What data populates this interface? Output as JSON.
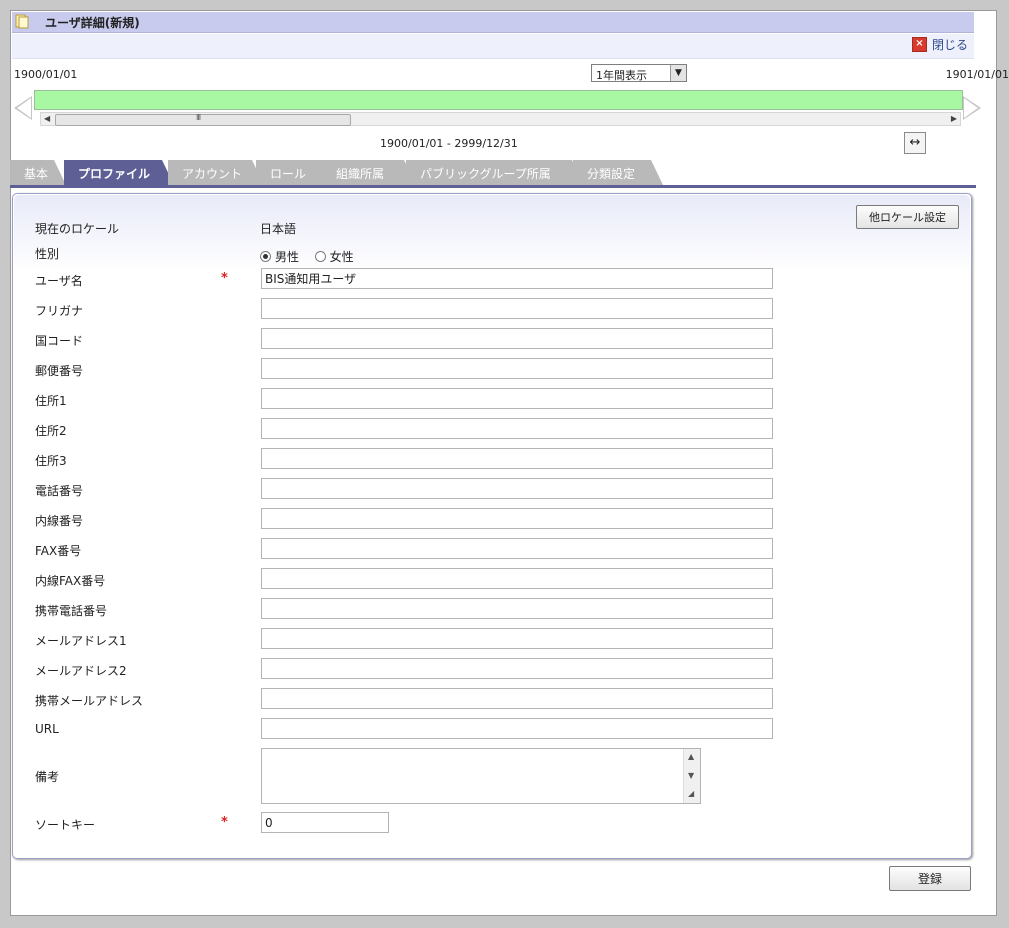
{
  "header": {
    "title": "ユーザ詳細(新規)",
    "close_label": "閉じる"
  },
  "timeline": {
    "start_date": "1900/01/01",
    "end_date": "1901/01/01",
    "period_select": "1年間表示",
    "range": "1900/01/01 - 2999/12/31",
    "bar_color": "#a8f7a3"
  },
  "tabs": [
    {
      "label": "基本",
      "active": false
    },
    {
      "label": "プロファイル",
      "active": true
    },
    {
      "label": "アカウント",
      "active": false
    },
    {
      "label": "ロール",
      "active": false
    },
    {
      "label": "組織所属",
      "active": false
    },
    {
      "label": "パブリックグループ所属",
      "active": false
    },
    {
      "label": "分類設定",
      "active": false
    }
  ],
  "form": {
    "locale_label": "現在のロケール",
    "locale_value": "日本語",
    "locale_button": "他ロケール設定",
    "gender_label": "性別",
    "gender_male": "男性",
    "gender_female": "女性",
    "required_mark": "*",
    "username_label": "ユーザ名",
    "username_value": "BIS通知用ユーザ",
    "fields": [
      {
        "label": "フリガナ",
        "value": ""
      },
      {
        "label": "国コード",
        "value": ""
      },
      {
        "label": "郵便番号",
        "value": ""
      },
      {
        "label": "住所1",
        "value": ""
      },
      {
        "label": "住所2",
        "value": ""
      },
      {
        "label": "住所3",
        "value": ""
      },
      {
        "label": "電話番号",
        "value": ""
      },
      {
        "label": "内線番号",
        "value": ""
      },
      {
        "label": "FAX番号",
        "value": ""
      },
      {
        "label": "内線FAX番号",
        "value": ""
      },
      {
        "label": "携帯電話番号",
        "value": ""
      },
      {
        "label": "メールアドレス1",
        "value": ""
      },
      {
        "label": "メールアドレス2",
        "value": ""
      },
      {
        "label": "携帯メールアドレス",
        "value": ""
      },
      {
        "label": "URL",
        "value": ""
      }
    ],
    "remarks_label": "備考",
    "sortkey_label": "ソートキー",
    "sortkey_value": "0"
  },
  "footer": {
    "submit_label": "登録"
  }
}
